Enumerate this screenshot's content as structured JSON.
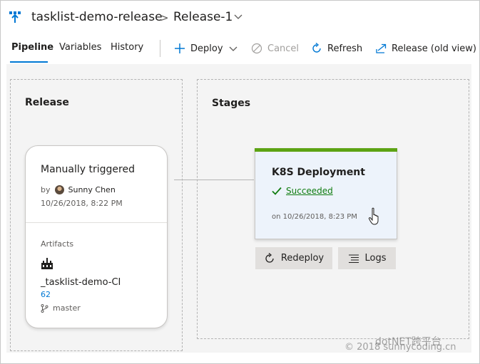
{
  "header": {
    "pipeline_name": "tasklist-demo-release",
    "separator": ">",
    "release_name": "Release-1"
  },
  "toolbar": {
    "tabs": [
      {
        "label": "Pipeline",
        "active": true
      },
      {
        "label": "Variables",
        "active": false
      },
      {
        "label": "History",
        "active": false
      }
    ],
    "deploy_label": "Deploy",
    "cancel_label": "Cancel",
    "refresh_label": "Refresh",
    "old_view_label": "Release (old view)"
  },
  "release_zone": {
    "title": "Release",
    "card": {
      "trigger": "Manually triggered",
      "by_label": "by",
      "user": "Sunny Chen",
      "date": "10/26/2018, 8:22 PM",
      "artifacts_label": "Artifacts",
      "artifact_name": "_tasklist-demo-CI",
      "build_number": "62",
      "branch": "master"
    }
  },
  "stages_zone": {
    "title": "Stages",
    "stage": {
      "name": "K8S Deployment",
      "status": "Succeeded",
      "date": "on 10/26/2018, 8:23 PM"
    },
    "redeploy_label": "Redeploy",
    "logs_label": "Logs"
  },
  "watermark": {
    "line1": "dotNET跨平台",
    "line2": "© 2018 sunnycoding.cn"
  },
  "colors": {
    "accent": "#0078d4",
    "success": "#107c10",
    "stage_bar": "#5ca313",
    "canvas_bg": "#f4f4f4"
  },
  "icons": {
    "pipeline": "release-pipeline-icon",
    "deploy": "plus-icon",
    "cancel": "cancel-icon",
    "refresh": "refresh-icon",
    "old_view": "open-external-icon",
    "artifact": "build-artifact-icon",
    "branch": "branch-icon",
    "status": "checkmark-icon",
    "redeploy": "redeploy-icon",
    "logs": "logs-icon"
  }
}
